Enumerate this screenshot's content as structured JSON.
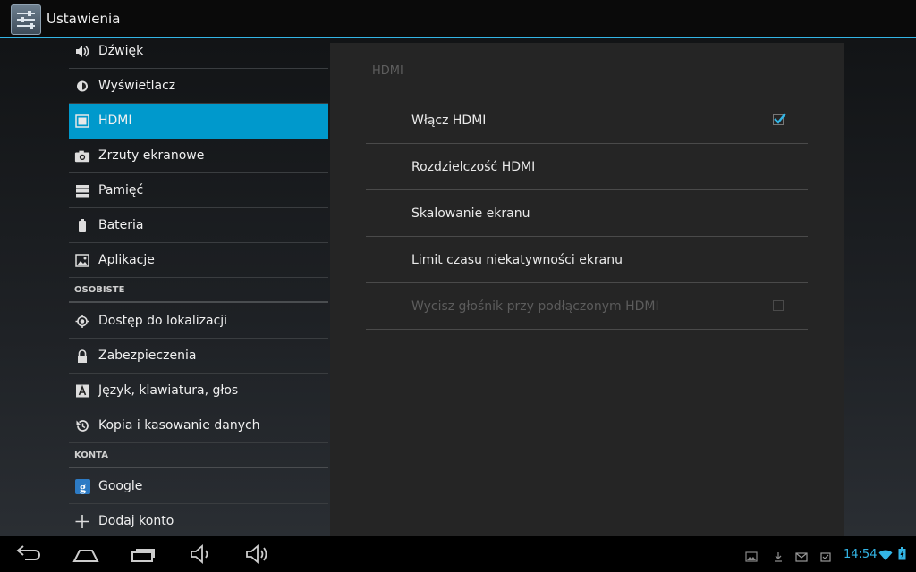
{
  "app": {
    "title": "Ustawienia",
    "icon": "settings-sliders-icon"
  },
  "sidebar": {
    "items": [
      {
        "label": "Dźwięk",
        "icon": "speaker-icon"
      },
      {
        "label": "Wyświetlacz",
        "icon": "brightness-icon"
      },
      {
        "label": "HDMI",
        "icon": "hdmi-icon",
        "selected": true
      },
      {
        "label": "Zrzuty ekranowe",
        "icon": "camera-icon"
      },
      {
        "label": "Pamięć",
        "icon": "storage-icon"
      },
      {
        "label": "Bateria",
        "icon": "battery-icon"
      },
      {
        "label": "Aplikacje",
        "icon": "apps-icon"
      },
      {
        "label": "Dostęp do lokalizacji",
        "icon": "location-icon"
      },
      {
        "label": "Zabezpieczenia",
        "icon": "lock-icon"
      },
      {
        "label": "Język, klawiatura, głos",
        "icon": "language-icon"
      },
      {
        "label": "Kopia i kasowanie danych",
        "icon": "backup-restore-icon"
      },
      {
        "label": "Google",
        "icon": "google-icon"
      },
      {
        "label": "Dodaj konto",
        "icon": "plus-icon"
      }
    ],
    "headers": {
      "personal": "OSOBISTE",
      "accounts": "KONTA"
    }
  },
  "detail": {
    "title": "HDMI",
    "prefs": [
      {
        "label": "Włącz HDMI",
        "checkbox": true,
        "checked": true,
        "enabled": true
      },
      {
        "label": "Rozdzielczość HDMI",
        "checkbox": false,
        "enabled": true
      },
      {
        "label": "Skalowanie ekranu",
        "checkbox": false,
        "enabled": true
      },
      {
        "label": "Limit czasu niekatywności ekranu",
        "checkbox": false,
        "enabled": true
      },
      {
        "label": "Wycisz głośnik przy podłączonym HDMI",
        "checkbox": true,
        "checked": false,
        "enabled": false
      }
    ]
  },
  "navbar": {
    "buttons": [
      "back-icon",
      "home-icon",
      "recent-apps-icon",
      "volume-down-icon",
      "volume-up-icon"
    ],
    "status_icons": [
      "image-notification-icon",
      "download-icon",
      "mail-icon",
      "task-icon"
    ],
    "clock": "14:54",
    "wifi": "wifi-icon",
    "battery": "battery-charging-icon"
  },
  "colors": {
    "accent": "#33b5e5",
    "selected": "#0099cc",
    "checkmark": "#33b5e5"
  }
}
